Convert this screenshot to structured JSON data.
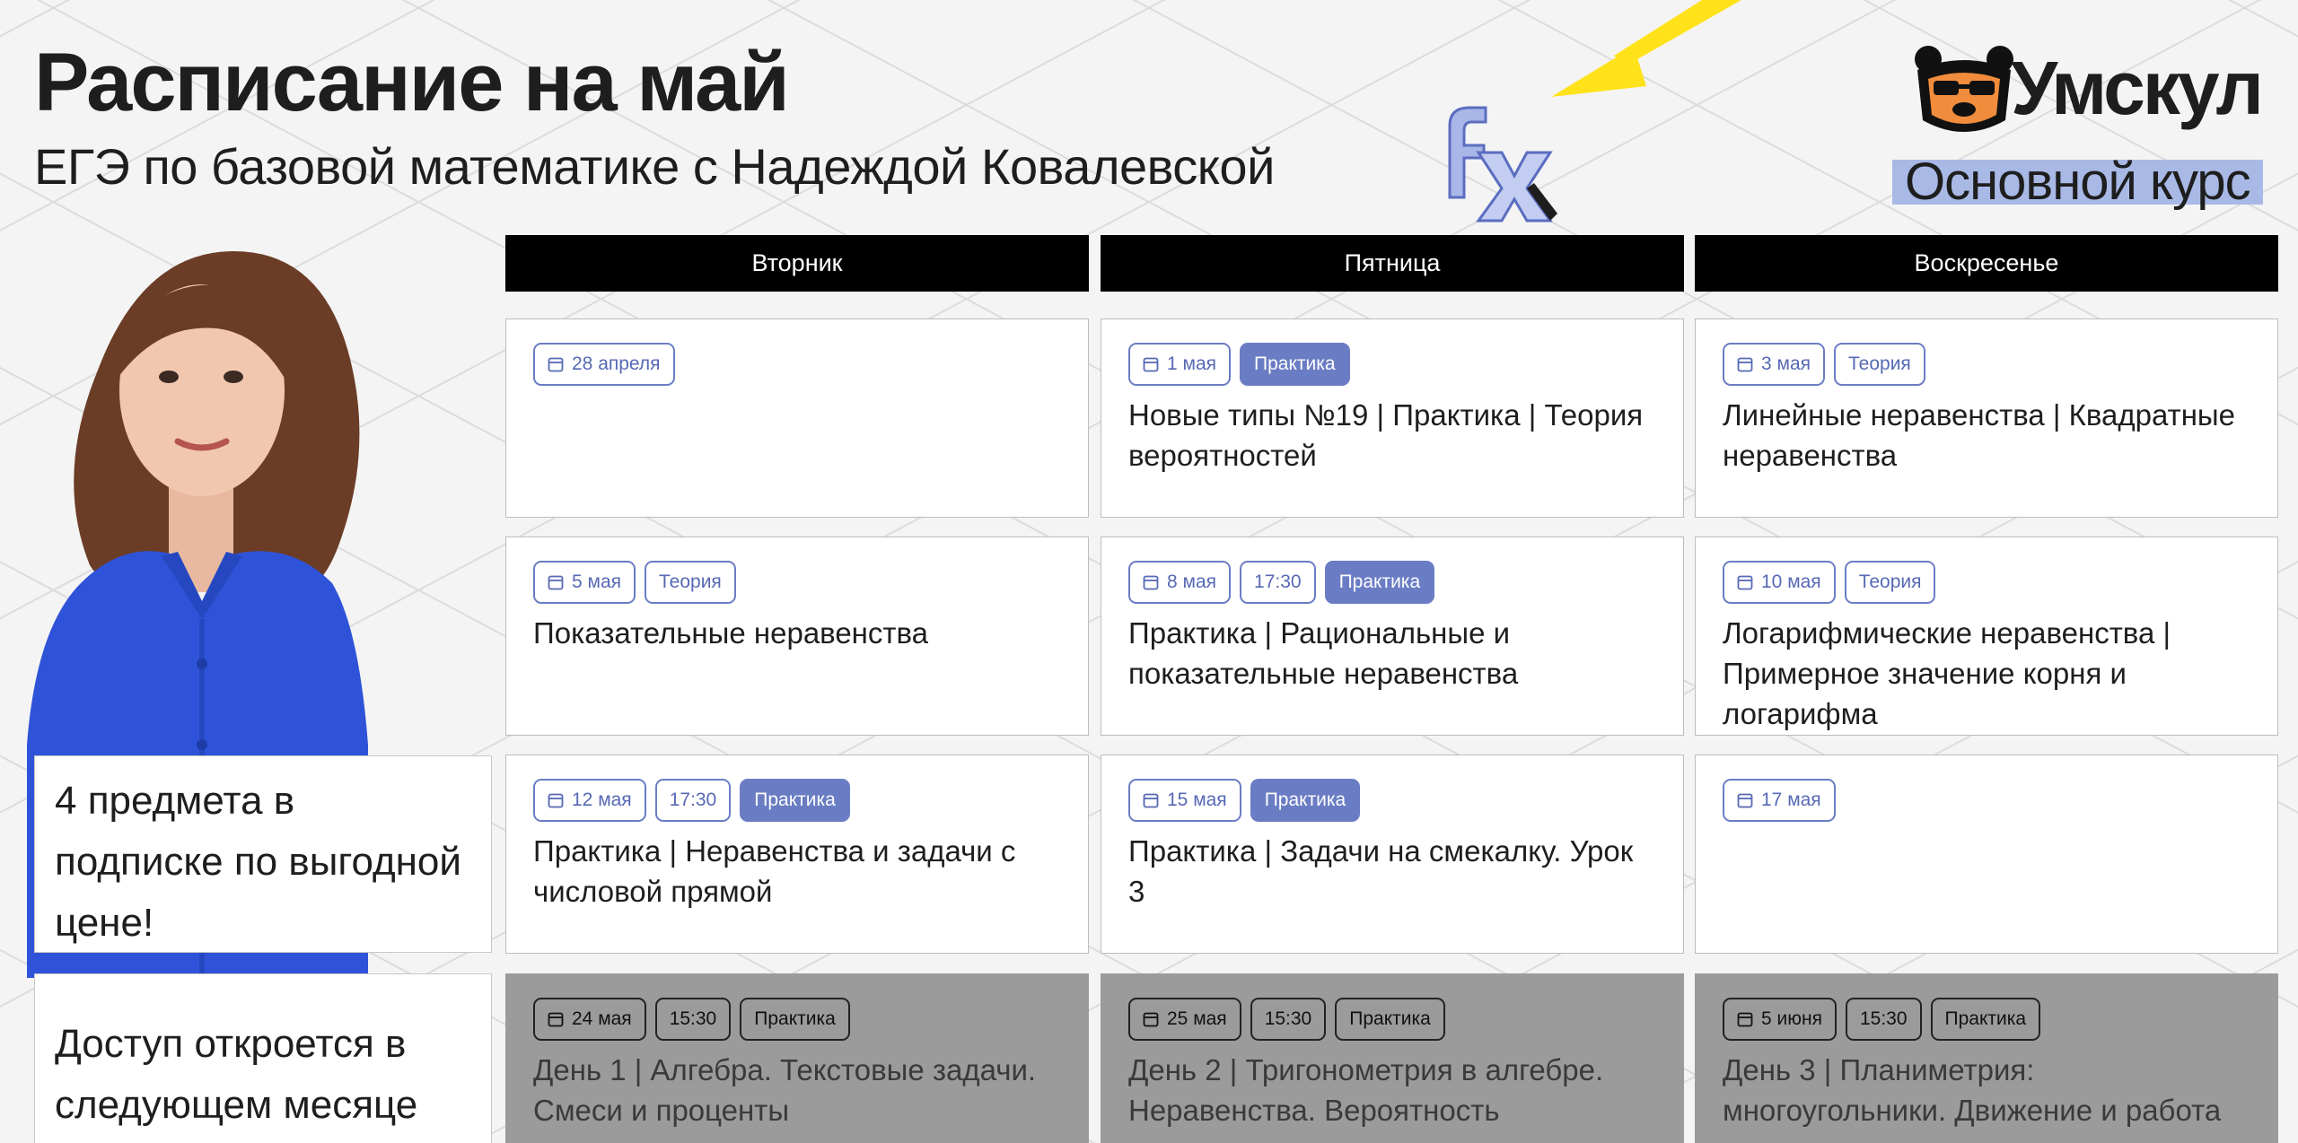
{
  "header": {
    "title": "Расписание на май",
    "subtitle": "ЕГЭ по базовой математике с Надеждой Ковалевской"
  },
  "brand": {
    "name": "Умскул",
    "course": "Основной курс",
    "accent_color": "#a9b9e6",
    "logo_color": "#f08c3c"
  },
  "promo": {
    "subscription": "4 предмета в подписке по выгодной цене!",
    "access": "Доступ откроется в следующем месяце"
  },
  "days": [
    "Вторник",
    "Пятница",
    "Воскресенье"
  ],
  "rows": [
    [
      {
        "date": "28 апреля",
        "time": "",
        "type": "",
        "title": ""
      },
      {
        "date": "1 мая",
        "time": "",
        "type": "Практика",
        "title": "Новые типы №19 | Практика | Теория вероятностей"
      },
      {
        "date": "3 мая",
        "time": "",
        "type": "Теория",
        "title": "Линейные неравенства | Квадратные неравенства"
      }
    ],
    [
      {
        "date": "5 мая",
        "time": "",
        "type": "Теория",
        "title": "Показательные неравенства"
      },
      {
        "date": "8 мая",
        "time": "17:30",
        "type": "Практика",
        "title": "Практика | Рациональные и показательные неравенства"
      },
      {
        "date": "10 мая",
        "time": "",
        "type": "Теория",
        "title": "Логарифмические неравенства | Примерное значение корня и логарифма"
      }
    ],
    [
      {
        "date": "12 мая",
        "time": "17:30",
        "type": "Практика",
        "title": "Практика | Неравенства и задачи с числовой прямой"
      },
      {
        "date": "15 мая",
        "time": "",
        "type": "Практика",
        "title": "Практика | Задачи на смекалку. Урок 3"
      },
      {
        "date": "17 мая",
        "time": "",
        "type": "",
        "title": ""
      }
    ],
    [
      {
        "date": "24 мая",
        "time": "15:30",
        "type": "Практика",
        "title": "День 1 | Алгебра. Текстовые задачи. Смеси и проценты"
      },
      {
        "date": "25 мая",
        "time": "15:30",
        "type": "Практика",
        "title": "День 2 | Тригонометрия в алгебре. Неравенства. Вероятность"
      },
      {
        "date": "5 июня",
        "time": "15:30",
        "type": "Практика",
        "title": "День 3 | Планиметрия: многоугольники. Движение и работа"
      }
    ]
  ]
}
